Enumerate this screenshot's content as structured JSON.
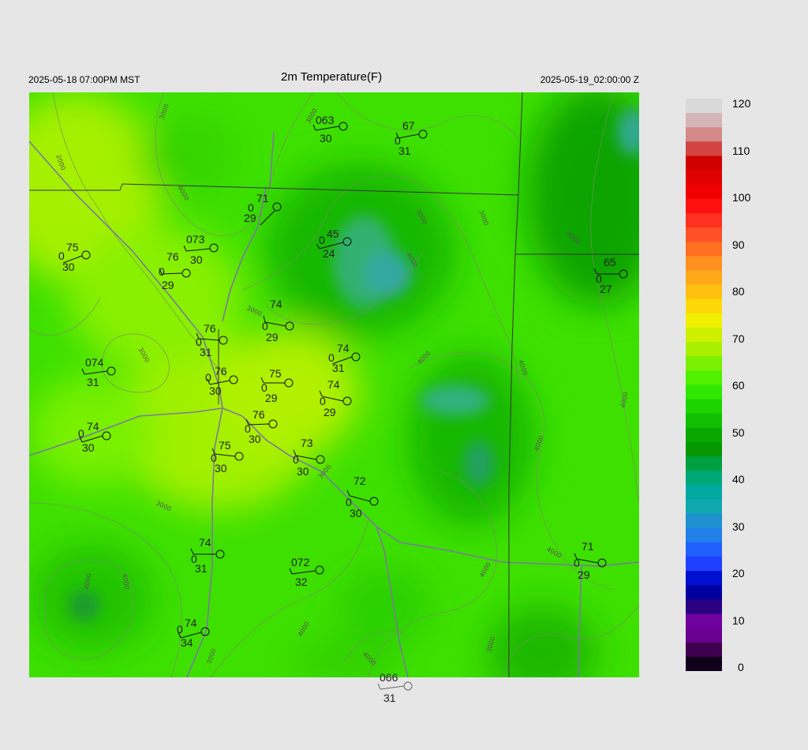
{
  "header": {
    "left": "2025-05-18 07:00PM MST",
    "title": "2m Temperature(F)",
    "right": "2025-05-19_02:00:00 Z"
  },
  "colorbar": {
    "ticks": [
      "120",
      "110",
      "100",
      "90",
      "80",
      "70",
      "60",
      "50",
      "40",
      "30",
      "20",
      "10",
      "0"
    ],
    "colors": [
      "#d9d9d9",
      "#d5b4b8",
      "#d58888",
      "#d24444",
      "#d00000",
      "#e00000",
      "#f00000",
      "#ff1010",
      "#ff3020",
      "#ff5028",
      "#ff7020",
      "#ff9020",
      "#ffa818",
      "#ffc010",
      "#ffd808",
      "#f0f000",
      "#ccf000",
      "#a8f000",
      "#7af000",
      "#50f000",
      "#30e800",
      "#1cd400",
      "#10c000",
      "#08a800",
      "#059800",
      "#00a040",
      "#00a878",
      "#00a8a0",
      "#10a8b0",
      "#2090d0",
      "#2080e8",
      "#2060ff",
      "#2040ff",
      "#0010d0",
      "#0000a0",
      "#280080",
      "#7000a0",
      "#6a0090",
      "#400050",
      "#10001a"
    ]
  },
  "contour_labels": [
    "2000",
    "3000",
    "4000"
  ],
  "stations": [
    {
      "temp": "063",
      "dew": "30"
    },
    {
      "temp": "67",
      "dew": "31"
    },
    {
      "temp": "71",
      "dew": "29"
    },
    {
      "temp": "45",
      "dew": "24"
    },
    {
      "temp": "75",
      "dew": "30"
    },
    {
      "temp": "073",
      "dew": "30"
    },
    {
      "temp": "76",
      "dew": "29"
    },
    {
      "temp": "65",
      "dew": "27"
    },
    {
      "temp": "74",
      "dew": "29"
    },
    {
      "temp": "76",
      "dew": "31"
    },
    {
      "temp": "074",
      "dew": "31"
    },
    {
      "temp": "76",
      "dew": "30"
    },
    {
      "temp": "75",
      "dew": "29"
    },
    {
      "temp": "74",
      "dew": "31"
    },
    {
      "temp": "74",
      "dew": "29"
    },
    {
      "temp": "74",
      "dew": "30"
    },
    {
      "temp": "76",
      "dew": "30"
    },
    {
      "temp": "75",
      "dew": "30"
    },
    {
      "temp": "73",
      "dew": "30"
    },
    {
      "temp": "72",
      "dew": "30"
    },
    {
      "temp": "74",
      "dew": "31"
    },
    {
      "temp": "072",
      "dew": "32"
    },
    {
      "temp": "71",
      "dew": "29"
    },
    {
      "temp": "74",
      "dew": "34"
    },
    {
      "temp": "066",
      "dew": "31"
    }
  ]
}
